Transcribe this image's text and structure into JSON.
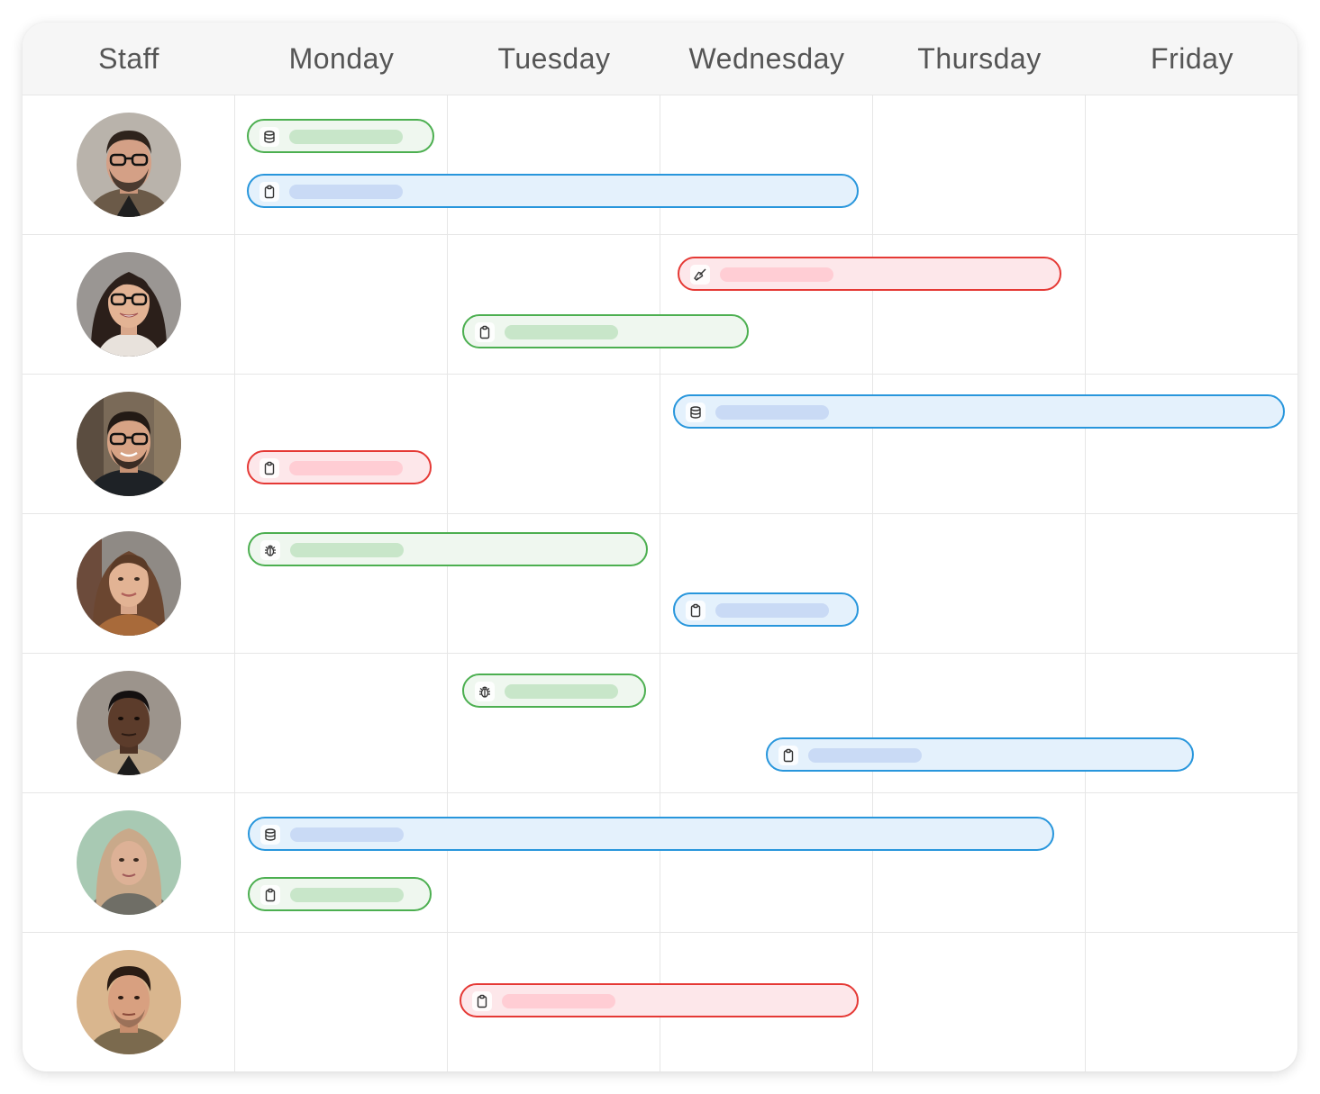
{
  "header": {
    "staff": "Staff",
    "days": [
      "Monday",
      "Tuesday",
      "Wednesday",
      "Thursday",
      "Friday"
    ]
  },
  "colors": {
    "green_border": "#4caf50",
    "green_fill": "#eff7ef",
    "blue_border": "#2896dc",
    "blue_fill": "#e4f1fc",
    "red_border": "#e53935",
    "red_fill": "#fde7ea"
  },
  "staff": [
    {
      "avatar": "avatar-man-glasses-beard",
      "tasks": [
        {
          "color": "green",
          "icon": "database-icon",
          "start_day": "Monday",
          "end_day": "Monday"
        },
        {
          "color": "blue",
          "icon": "clipboard-icon",
          "start_day": "Monday",
          "end_day": "Wednesday"
        }
      ]
    },
    {
      "avatar": "avatar-woman-glasses",
      "tasks": [
        {
          "color": "red",
          "icon": "brush-icon",
          "start_day": "Wednesday",
          "end_day": "Thursday"
        },
        {
          "color": "green",
          "icon": "clipboard-icon",
          "start_day": "Tuesday",
          "end_day": "Wednesday"
        }
      ]
    },
    {
      "avatar": "avatar-man-glasses-smile",
      "tasks": [
        {
          "color": "blue",
          "icon": "database-icon",
          "start_day": "Wednesday",
          "end_day": "Friday"
        },
        {
          "color": "red",
          "icon": "clipboard-icon",
          "start_day": "Monday",
          "end_day": "Monday"
        }
      ]
    },
    {
      "avatar": "avatar-woman-long-hair",
      "tasks": [
        {
          "color": "green",
          "icon": "bug-icon",
          "start_day": "Monday",
          "end_day": "Tuesday"
        },
        {
          "color": "blue",
          "icon": "clipboard-icon",
          "start_day": "Wednesday",
          "end_day": "Wednesday"
        }
      ]
    },
    {
      "avatar": "avatar-man-short-hair",
      "tasks": [
        {
          "color": "green",
          "icon": "bug-icon",
          "start_day": "Tuesday",
          "end_day": "Tuesday"
        },
        {
          "color": "blue",
          "icon": "clipboard-icon",
          "start_day": "Wednesday",
          "end_day": "Friday"
        }
      ]
    },
    {
      "avatar": "avatar-woman-hijab",
      "tasks": [
        {
          "color": "blue",
          "icon": "database-icon",
          "start_day": "Monday",
          "end_day": "Thursday"
        },
        {
          "color": "green",
          "icon": "clipboard-icon",
          "start_day": "Monday",
          "end_day": "Monday"
        }
      ]
    },
    {
      "avatar": "avatar-young-man",
      "tasks": [
        {
          "color": "red",
          "icon": "clipboard-icon",
          "start_day": "Tuesday",
          "end_day": "Wednesday"
        }
      ]
    }
  ]
}
